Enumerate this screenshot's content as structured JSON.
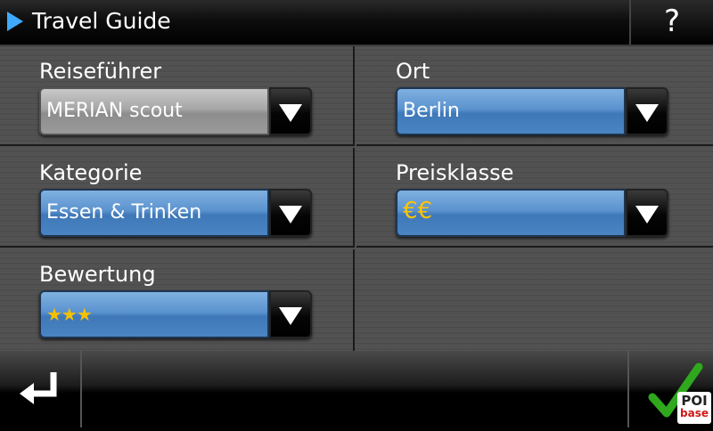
{
  "header": {
    "title": "Travel Guide",
    "help_label": "?"
  },
  "fields": {
    "reisefuehrer": {
      "label": "Reiseführer",
      "value": "MERIAN scout"
    },
    "ort": {
      "label": "Ort",
      "value": "Berlin"
    },
    "kategorie": {
      "label": "Kategorie",
      "value": "Essen & Trinken"
    },
    "preisklasse": {
      "label": "Preisklasse",
      "value": "€€"
    },
    "bewertung": {
      "label": "Bewertung",
      "value": "★★★"
    }
  },
  "footer": {
    "back_icon": "return-arrow-icon",
    "confirm_icon": "checkmark-icon",
    "logo_line1": "POI",
    "logo_line2": "base"
  },
  "colors": {
    "accent_blue": "#4a84c2",
    "check_green": "#2fa81e",
    "euro_gold": "#ffc400"
  }
}
